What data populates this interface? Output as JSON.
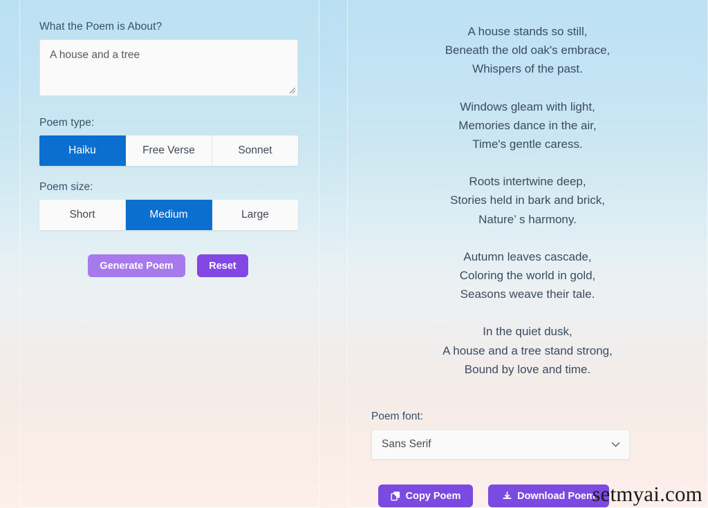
{
  "form": {
    "prompt_label": "What the Poem is About?",
    "prompt_value": "A house and a tree",
    "prompt_placeholder": "A house and a tree",
    "type_label": "Poem type:",
    "type_options": [
      "Haiku",
      "Free Verse",
      "Sonnet"
    ],
    "type_selected": "Haiku",
    "size_label": "Poem size:",
    "size_options": [
      "Short",
      "Medium",
      "Large"
    ],
    "size_selected": "Medium",
    "generate_label": "Generate Poem",
    "reset_label": "Reset"
  },
  "result": {
    "stanzas": [
      [
        "A house stands so still,",
        "Beneath the old oak's embrace,",
        "Whispers of the past."
      ],
      [
        "Windows gleam with light,",
        "Memories dance in the air,",
        "Time's gentle caress."
      ],
      [
        "Roots intertwine deep,",
        "Stories held in bark and brick,",
        "Nature’ s harmony."
      ],
      [
        "Autumn leaves cascade,",
        "Coloring the world in gold,",
        "Seasons weave their tale."
      ],
      [
        "In the quiet dusk,",
        "A house and a tree stand strong,",
        "Bound by love and time."
      ]
    ],
    "font_label": "Poem font:",
    "font_selected": "Sans Serif",
    "copy_label": "Copy Poem",
    "download_label": "Download Poem"
  },
  "watermark": "setmyai.com",
  "colors": {
    "accent_blue": "#0b6fd0",
    "purple_strong": "#8247e5",
    "purple_light": "#a679ec",
    "purple_action": "#7b4ae0",
    "text_primary": "#35506b",
    "poem_text": "#3a4c60"
  },
  "icons": {
    "resize": "resize-grip-icon",
    "chevron": "chevron-down-icon",
    "copy": "copy-icon",
    "download": "download-icon"
  }
}
